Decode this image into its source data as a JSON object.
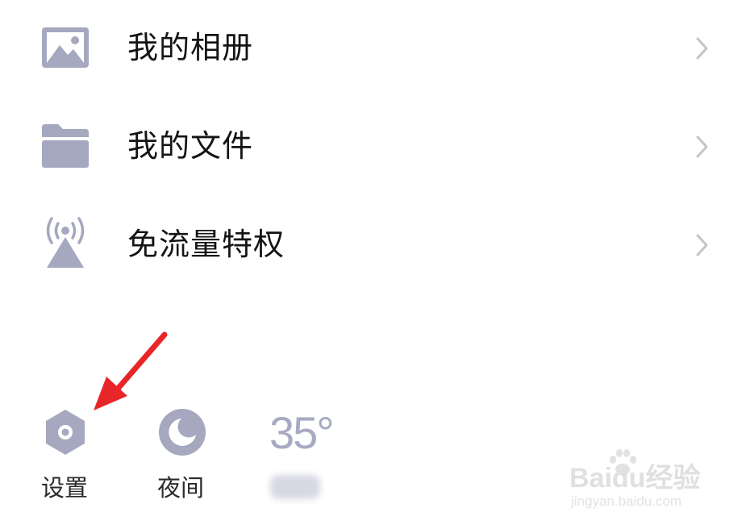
{
  "menu": {
    "items": [
      {
        "label": "我的相册",
        "icon": "photo-album-icon"
      },
      {
        "label": "我的文件",
        "icon": "folder-icon"
      },
      {
        "label": "免流量特权",
        "icon": "signal-tower-icon"
      }
    ]
  },
  "quick_actions": {
    "settings_label": "设置",
    "night_label": "夜间",
    "weather_temp": "35°",
    "weather_city": "西会"
  },
  "annotation": {
    "arrow_icon": "red-arrow-icon",
    "arrow_color": "#e8262a"
  },
  "watermark": {
    "brand": "Baidu经验",
    "url": "jingyan.baidu.com"
  },
  "colors": {
    "icon_gray": "#a5a8be",
    "text": "#141414",
    "chevron": "#c4c4c8"
  }
}
